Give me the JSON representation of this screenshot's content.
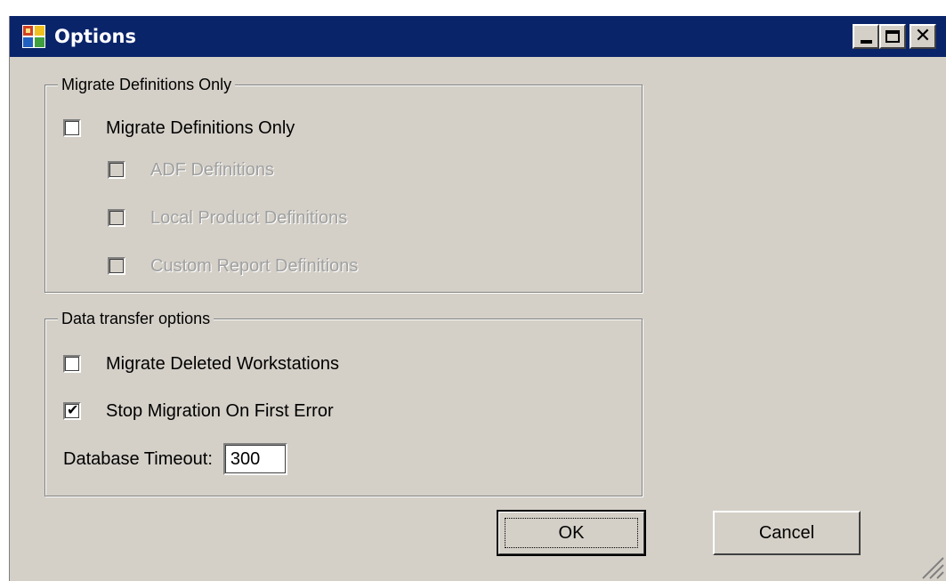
{
  "window": {
    "title": "Options"
  },
  "group_definitions": {
    "legend": "Migrate Definitions Only",
    "items": [
      {
        "label": "Migrate Definitions Only",
        "checked": false,
        "enabled": true
      },
      {
        "label": "ADF Definitions",
        "checked": false,
        "enabled": false
      },
      {
        "label": "Local Product Definitions",
        "checked": false,
        "enabled": false
      },
      {
        "label": "Custom Report Definitions",
        "checked": false,
        "enabled": false
      }
    ]
  },
  "group_transfer": {
    "legend": "Data transfer options",
    "items": [
      {
        "label": "Migrate Deleted Workstations",
        "checked": false,
        "enabled": true
      },
      {
        "label": "Stop Migration On First Error",
        "checked": true,
        "enabled": true
      }
    ],
    "timeout_label": "Database Timeout:",
    "timeout_value": "300"
  },
  "buttons": {
    "ok_label": "OK",
    "cancel_label": "Cancel"
  },
  "colors": {
    "titlebar": "#0a246a",
    "face": "#d4d0c8",
    "disabled_text": "#a0a0a0"
  }
}
